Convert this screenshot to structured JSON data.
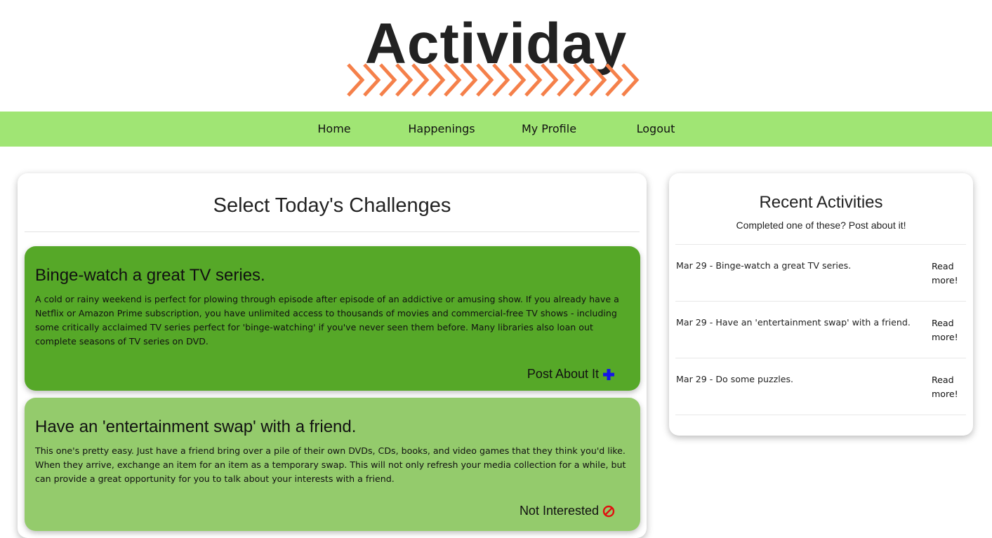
{
  "logo": {
    "text": "Actividay",
    "accent_color": "#f5804a"
  },
  "nav": {
    "background": "#a0e574",
    "items": [
      {
        "label": "Home"
      },
      {
        "label": "Happenings"
      },
      {
        "label": "My Profile"
      },
      {
        "label": "Logout"
      }
    ]
  },
  "challenges": {
    "title": "Select Today's Challenges",
    "items": [
      {
        "title": "Binge-watch a great TV series.",
        "body": "A cold or rainy weekend is perfect for plowing through episode after episode of an addictive or amusing show. If you already have a Netflix or Amazon Prime subscription, you have unlimited access to thousands of movies and commercial-free TV shows - including some critically acclaimed TV series perfect for 'binge-watching' if you've never seen them before. Many libraries also loan out complete seasons of TV series on DVD.",
        "action_label": "Post About It",
        "action_icon": "plus-icon",
        "color": "#56a828"
      },
      {
        "title": "Have an 'entertainment swap' with a friend.",
        "body": "This one's pretty easy. Just have a friend bring over a pile of their own DVDs, CDs, books, and video games that they think you'd like. When they arrive, exchange an item for an item as a temporary swap. This will not only refresh your media collection for a while, but can provide a great opportunity for you to talk about your interests with a friend.",
        "action_label": "Not Interested",
        "action_icon": "prohibited-icon",
        "color": "#94cb6c"
      }
    ]
  },
  "recent": {
    "title": "Recent Activities",
    "subtitle": "Completed one of these? Post about it!",
    "items": [
      {
        "text": "Mar 29 - Binge-watch a great TV series.",
        "link": "Read more!"
      },
      {
        "text": "Mar 29 - Have an 'entertainment swap' with a friend.",
        "link": "Read more!"
      },
      {
        "text": "Mar 29 - Do some puzzles.",
        "link": "Read more!"
      }
    ]
  }
}
